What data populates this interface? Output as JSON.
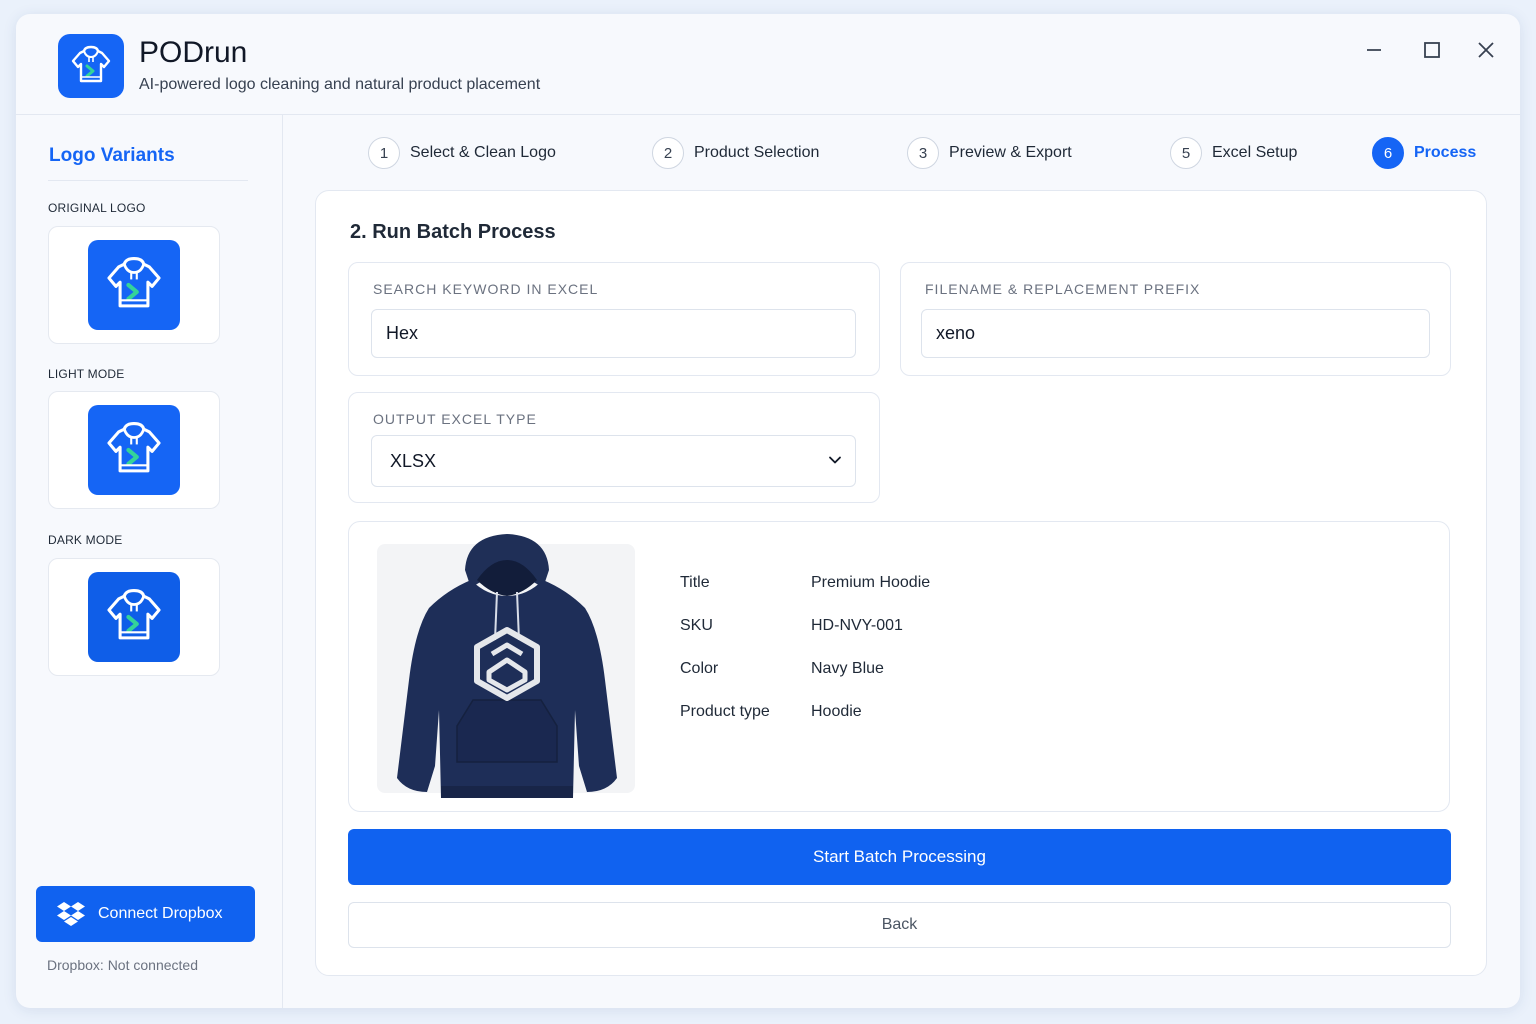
{
  "app": {
    "title": "PODrun",
    "subtitle": "AI-powered logo cleaning and natural product placement",
    "logo_icon": "hoodie-arrow-icon",
    "accent_color": "#1565f5"
  },
  "window_controls": {
    "minimize_icon": "minimize-icon",
    "maximize_icon": "maximize-icon",
    "close_icon": "close-icon"
  },
  "sidebar": {
    "heading": "Logo Variants",
    "variants": [
      {
        "label": "ORIGINAL LOGO",
        "icon": "hoodie-arrow-icon"
      },
      {
        "label": "LIGHT MODE",
        "icon": "hoodie-arrow-icon"
      },
      {
        "label": "DARK MODE",
        "icon": "hoodie-arrow-icon"
      }
    ],
    "dropbox_button": "Connect Dropbox",
    "dropbox_status": "Dropbox: Not connected"
  },
  "steps": [
    {
      "num": "1",
      "label": "Select & Clean Logo",
      "active": false
    },
    {
      "num": "2",
      "label": "Product Selection",
      "active": false
    },
    {
      "num": "3",
      "label": "Preview & Export",
      "active": false
    },
    {
      "num": "5",
      "label": "Excel Setup",
      "active": false
    },
    {
      "num": "6",
      "label": "Process",
      "active": true
    }
  ],
  "panel": {
    "title": "2. Run Batch Process",
    "search_keyword": {
      "label": "SEARCH KEYWORD IN EXCEL",
      "value": "Hex"
    },
    "filename_prefix": {
      "label": "FILENAME & REPLACEMENT PREFIX",
      "value": "xeno"
    },
    "output_type": {
      "label": "OUTPUT EXCEL TYPE",
      "value": "XLSX"
    },
    "product": {
      "image": "navy-hoodie-hexagon-logo",
      "specs": [
        {
          "key": "Title",
          "value": "Premium Hoodie"
        },
        {
          "key": "SKU",
          "value": "HD-NVY-001"
        },
        {
          "key": "Color",
          "value": "Navy Blue"
        },
        {
          "key": "Product type",
          "value": "Hoodie"
        }
      ]
    },
    "start_button": "Start Batch Processing",
    "back_button": "Back"
  }
}
